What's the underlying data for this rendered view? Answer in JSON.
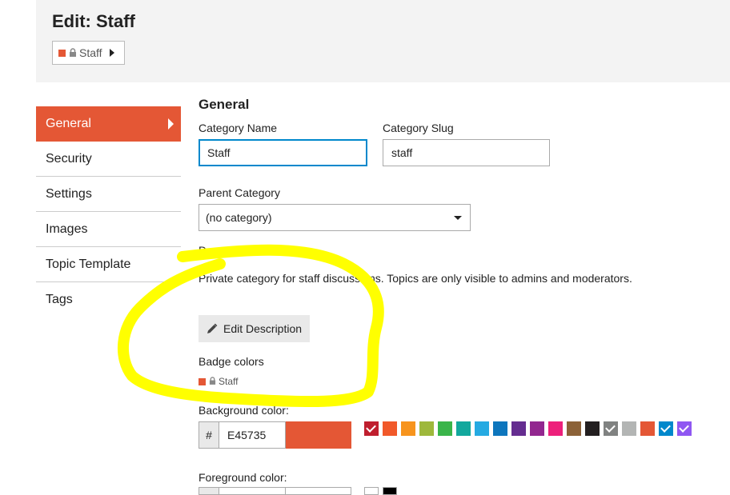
{
  "header": {
    "title": "Edit: Staff",
    "breadcrumb": {
      "color": "#E45735",
      "icon": "lock-icon",
      "label": "Staff"
    }
  },
  "nav": {
    "items": [
      {
        "label": "General",
        "active": true
      },
      {
        "label": "Security"
      },
      {
        "label": "Settings"
      },
      {
        "label": "Images"
      },
      {
        "label": "Topic Template"
      },
      {
        "label": "Tags"
      }
    ]
  },
  "form": {
    "section_title": "General",
    "category_name": {
      "label": "Category Name",
      "value": "Staff"
    },
    "category_slug": {
      "label": "Category Slug",
      "value": "staff"
    },
    "parent_category": {
      "label": "Parent Category",
      "selected": "(no category)"
    },
    "description": {
      "label": "Description",
      "text": "Private category for staff discussions. Topics are only visible to admins and moderators."
    },
    "edit_description_button": "Edit Description",
    "badge_colors": {
      "label": "Badge colors",
      "preview_label": "Staff"
    },
    "background_color": {
      "label": "Background color:",
      "hash": "#",
      "value": "E45735",
      "swatches": [
        "#BF1E2E",
        "#F1592A",
        "#F7941D",
        "#9EB83B",
        "#3AB54A",
        "#12A89D",
        "#25AAE2",
        "#0E76BD",
        "#652D90",
        "#92278F",
        "#ED207B",
        "#8C6238",
        "#231F20",
        "#808281",
        "#B3B5B4",
        "#E45735",
        "#0088CC",
        "#8F57F2"
      ],
      "checked": [
        "#BF1E2E",
        "#808281",
        "#0088CC",
        "#8F57F2"
      ]
    },
    "foreground_color": {
      "label": "Foreground color:"
    }
  },
  "colors": {
    "accent": "#E45735",
    "highlight": "#FFFF00",
    "focus": "#0088CC"
  }
}
